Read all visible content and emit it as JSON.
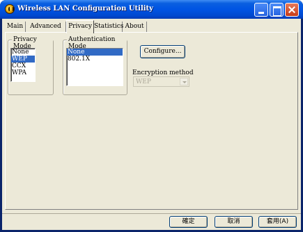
{
  "window": {
    "title": "Wireless LAN Configuration Utility"
  },
  "tabs": [
    {
      "label": "Main",
      "active": false
    },
    {
      "label": "Advanced",
      "active": false
    },
    {
      "label": "Privacy",
      "active": true
    },
    {
      "label": "Statistics",
      "active": false
    },
    {
      "label": "About",
      "active": false
    }
  ],
  "privacy_mode": {
    "label": "Privacy Mode",
    "items": [
      "None",
      "WEP",
      "CCX",
      "WPA"
    ],
    "selected": "WEP"
  },
  "authentication_mode": {
    "label": "Authentication Mode",
    "items": [
      "None",
      "802.1X"
    ],
    "selected": "None"
  },
  "configure_button": "Configure...",
  "encryption": {
    "label": "Encryption method",
    "value": "WEP",
    "disabled": true
  },
  "footer_buttons": {
    "ok": "確定",
    "cancel": "取消",
    "apply": "套用(A)"
  },
  "colors": {
    "titlebar": "#0054e3",
    "selection": "#316ac5",
    "face": "#ece9d8"
  }
}
